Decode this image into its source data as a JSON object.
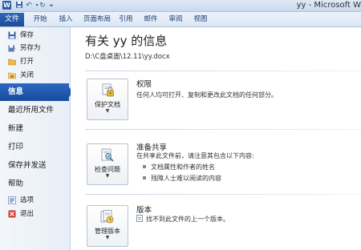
{
  "titlebar": {
    "app_letter": "W",
    "title": "yy - Microsoft W"
  },
  "ribbon": {
    "file_tab": "文件",
    "tabs": [
      "开始",
      "插入",
      "页面布局",
      "引用",
      "邮件",
      "审阅",
      "视图"
    ]
  },
  "nav": {
    "commands_top": [
      {
        "label": "保存",
        "icon": "save-icon"
      },
      {
        "label": "另存为",
        "icon": "save-as-icon"
      },
      {
        "label": "打开",
        "icon": "open-folder-icon"
      },
      {
        "label": "关闭",
        "icon": "close-document-icon"
      }
    ],
    "tabs": [
      "信息",
      "最近所用文件",
      "新建",
      "打印",
      "保存并发送",
      "帮助"
    ],
    "active_tab": "信息",
    "commands_bottom": [
      {
        "label": "选项",
        "icon": "options-icon"
      },
      {
        "label": "退出",
        "icon": "exit-icon"
      }
    ]
  },
  "info": {
    "title": "有关 yy 的信息",
    "path": "D:\\C盘桌面\\12.11\\yy.docx",
    "permissions": {
      "button": "保护文档",
      "title": "权限",
      "description": "任何人均可打开、复制和更改此文档的任何部分。"
    },
    "prepare": {
      "button": "检查问题",
      "title": "准备共享",
      "description": "在共享此文件前，请注意其包含以下内容:",
      "items": [
        "文档属性和作者的姓名",
        "残障人士难以阅读的内容"
      ]
    },
    "versions": {
      "button": "管理版本",
      "title": "版本",
      "description": "找不到此文件的上一个版本。"
    }
  },
  "colors": {
    "accent": "#1d55a8",
    "file_tab": "#2a5caa"
  }
}
